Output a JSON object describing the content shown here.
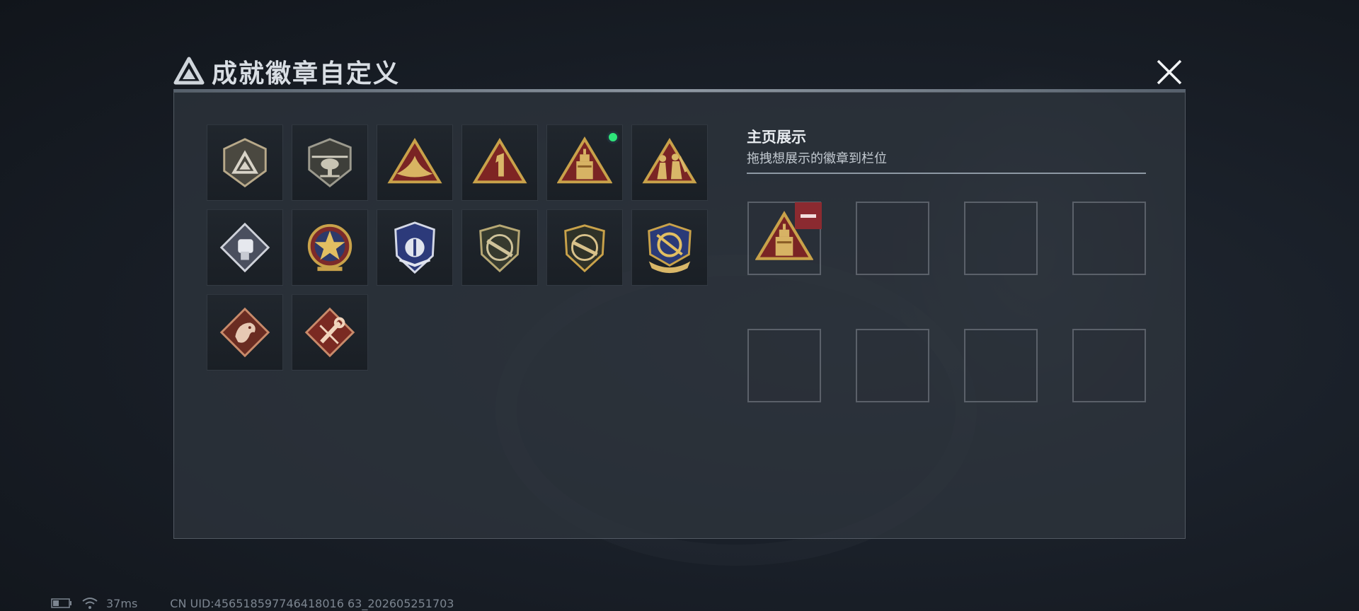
{
  "title": "成就徽章自定义",
  "showcase": {
    "title": "主页展示",
    "subtitle": "拖拽想展示的徽章到栏位"
  },
  "badges": [
    {
      "name": "grey-shield-logo-badge-icon",
      "new": false
    },
    {
      "name": "helicopter-shield-badge-icon",
      "new": false
    },
    {
      "name": "gold-bird-triangle-badge-icon",
      "new": false
    },
    {
      "name": "number-one-triangle-badge-icon",
      "new": false
    },
    {
      "name": "drink-cup-triangle-badge-icon",
      "new": true
    },
    {
      "name": "soldiers-triangle-badge-icon",
      "new": false
    },
    {
      "name": "silver-fist-diamond-badge-icon",
      "new": false
    },
    {
      "name": "gold-star-round-badge-icon",
      "new": false
    },
    {
      "name": "blue-wing-shield-badge-icon",
      "new": false
    },
    {
      "name": "rifle-shield-badge-icon",
      "new": false
    },
    {
      "name": "rifle-shield-gold-badge-icon",
      "new": false
    },
    {
      "name": "anchor-ribbon-badge-icon",
      "new": false
    },
    {
      "name": "dragon-diamond-badge-icon",
      "new": false
    },
    {
      "name": "wrench-diamond-badge-icon",
      "new": false
    }
  ],
  "showcase_slots": [
    {
      "badge": "drink-cup-triangle-badge-icon",
      "filled": true
    },
    {
      "filled": false
    },
    {
      "filled": false
    },
    {
      "filled": false
    },
    {
      "filled": false
    },
    {
      "filled": false
    },
    {
      "filled": false
    },
    {
      "filled": false
    }
  ],
  "status": {
    "ping": "37ms",
    "uid": "CN UID:456518597746418016 63_202605251703"
  },
  "colors": {
    "accent_green": "#2ee57a",
    "remove_red": "#8b2a30",
    "gold": "#c9a24a"
  }
}
